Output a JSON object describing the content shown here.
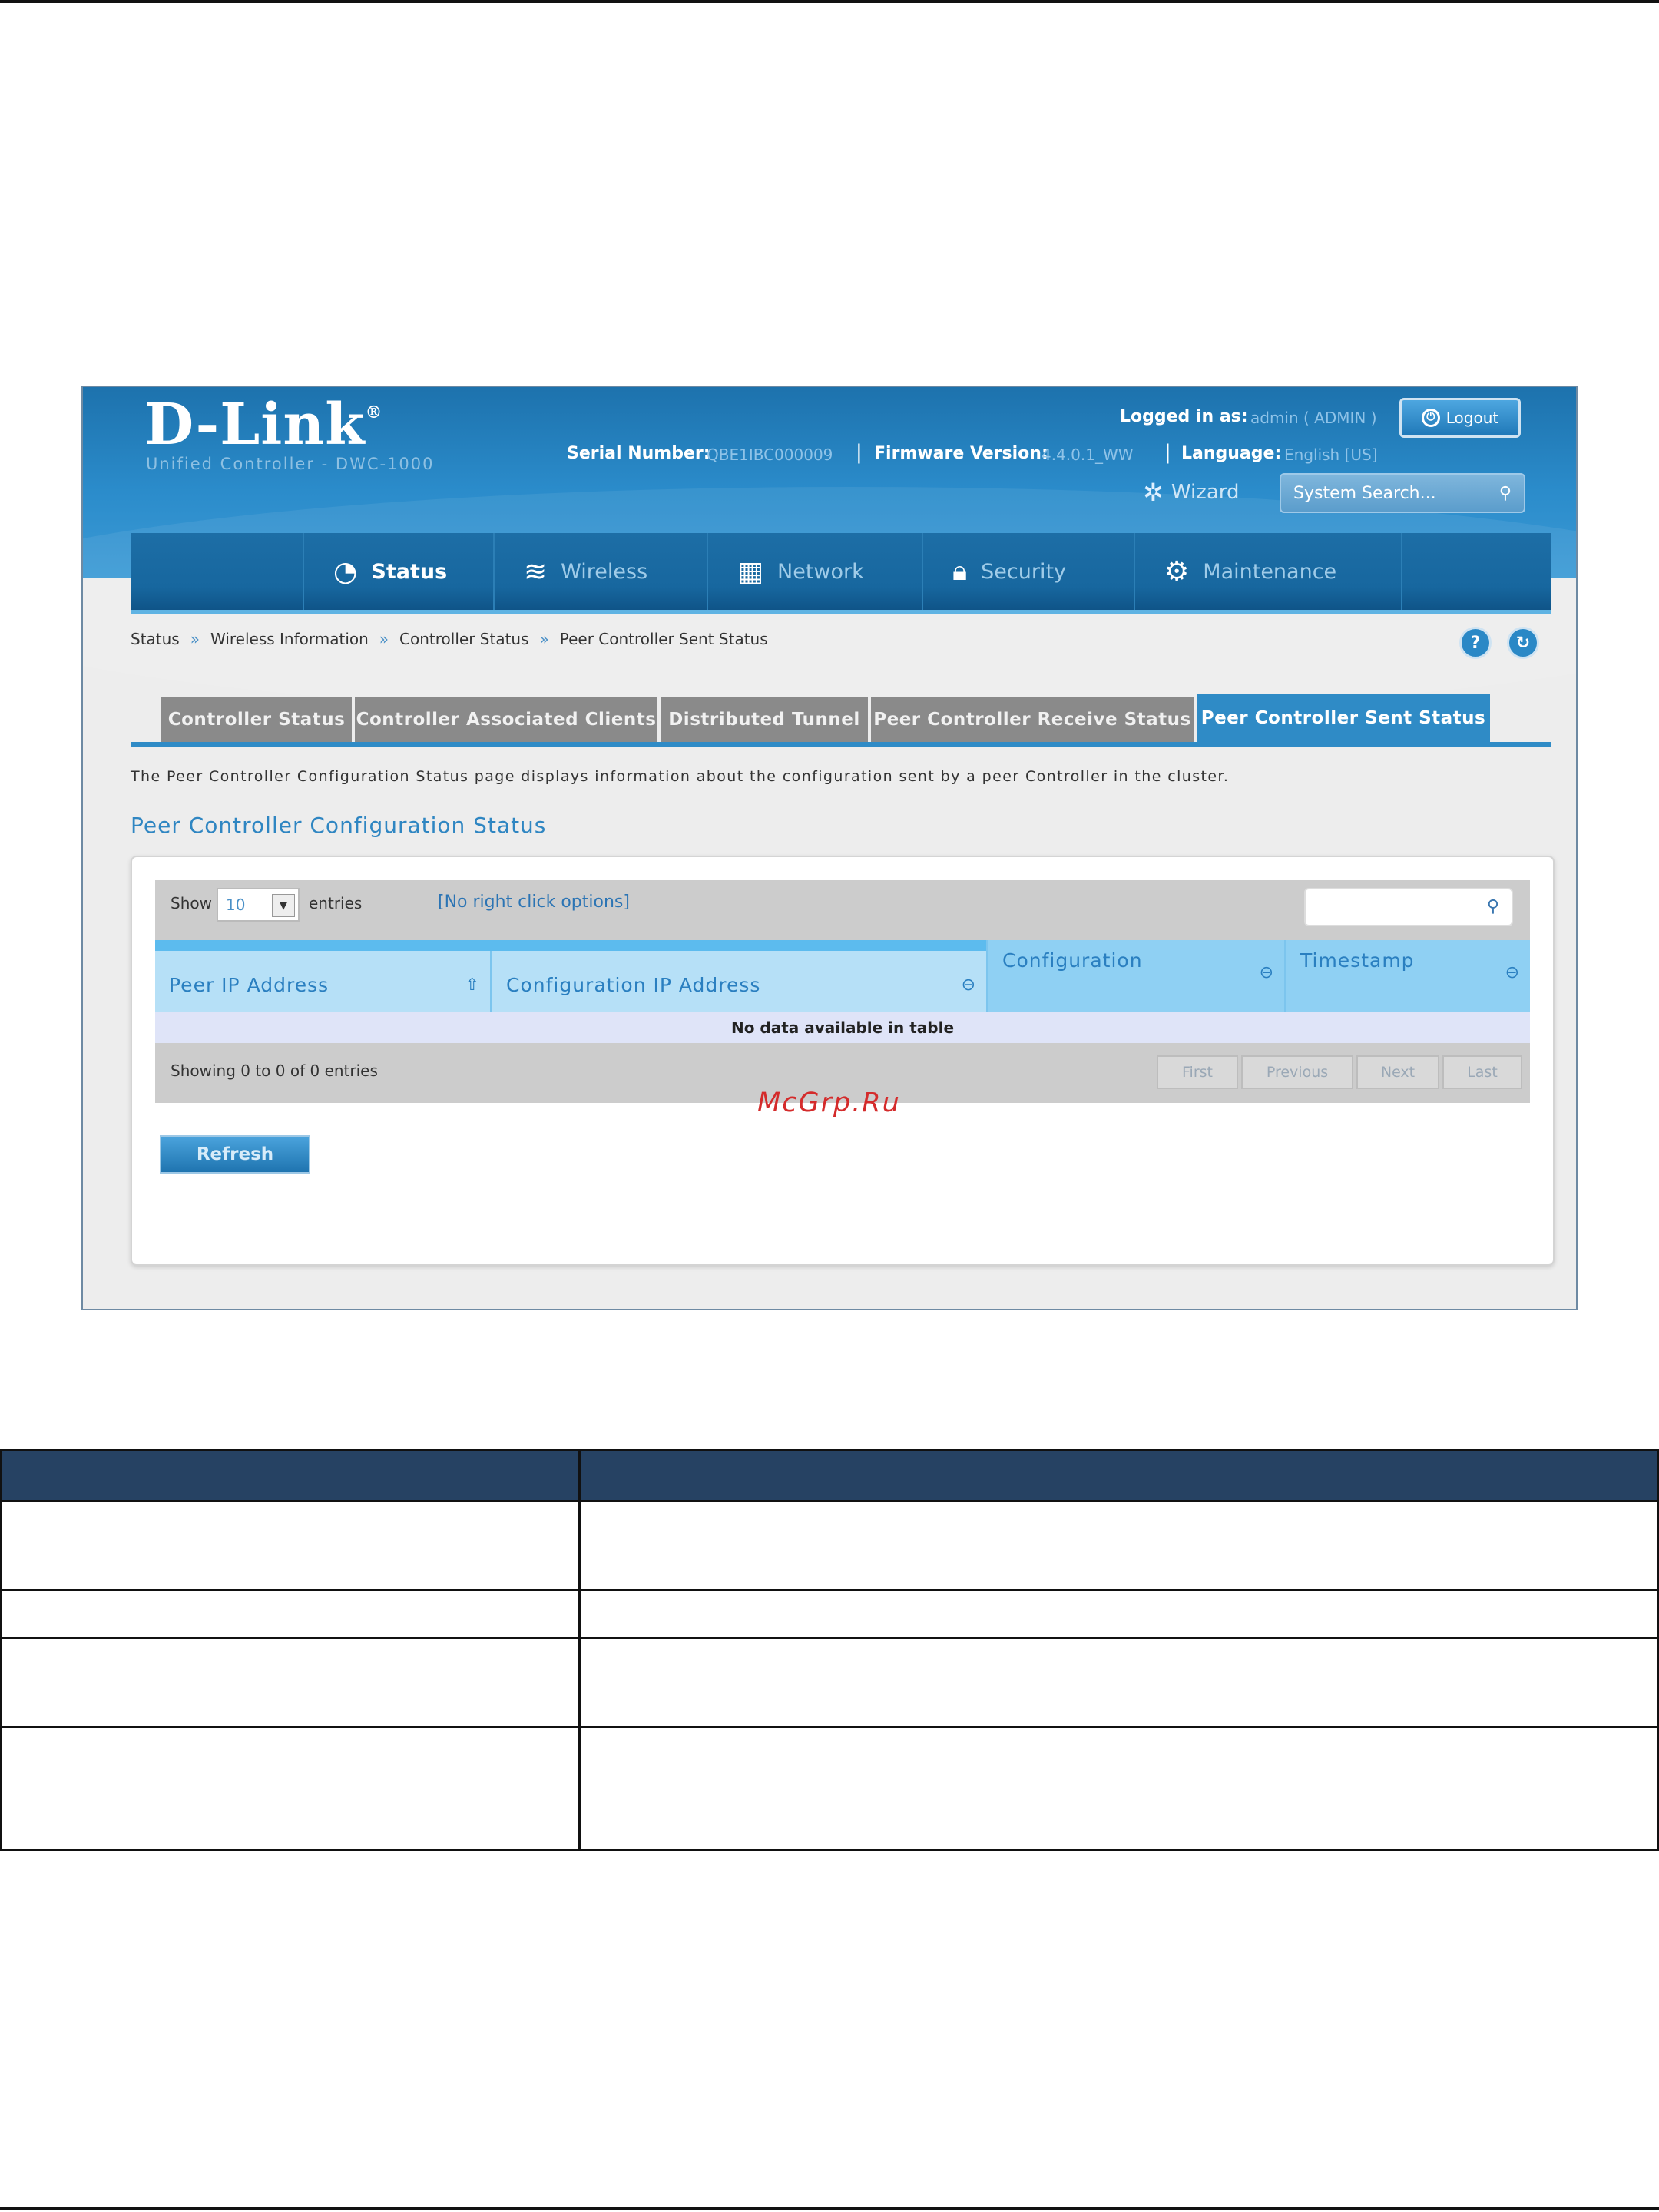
{
  "header": {
    "logo": "D-Link",
    "logo_mark": "®",
    "subtitle": "Unified Controller - DWC-1000",
    "logged_in_label": "Logged in as:",
    "logged_in_user": "admin ( ADMIN )",
    "logout_label": "Logout",
    "serial_label": "Serial Number:",
    "serial_value": "QBE1IBC000009",
    "firmware_label": "Firmware Version:",
    "firmware_value": "4.4.0.1_WW",
    "language_label": "Language:",
    "language_value": "English [US]",
    "wizard_label": "Wizard",
    "search_placeholder": "System Search..."
  },
  "nav": [
    {
      "label": "Status",
      "icon": "gauge-icon",
      "active": true
    },
    {
      "label": "Wireless",
      "icon": "wifi-icon",
      "active": false
    },
    {
      "label": "Network",
      "icon": "network-icon",
      "active": false
    },
    {
      "label": "Security",
      "icon": "lock-icon",
      "active": false
    },
    {
      "label": "Maintenance",
      "icon": "gears-icon",
      "active": false
    }
  ],
  "breadcrumb": [
    "Status",
    "Wireless Information",
    "Controller Status",
    "Peer Controller Sent Status"
  ],
  "breadcrumb_sep": "»",
  "tabs": [
    {
      "label": "Controller Status",
      "active": false
    },
    {
      "label": "Controller Associated Clients",
      "active": false
    },
    {
      "label": "Distributed Tunnel",
      "active": false
    },
    {
      "label": "Peer Controller Receive Status",
      "active": false
    },
    {
      "label": "Peer Controller Sent Status",
      "active": true
    }
  ],
  "description": "The Peer Controller Configuration Status page displays information about the configuration sent by a peer Controller in the cluster.",
  "section_title": "Peer Controller Configuration Status",
  "table": {
    "show_label": "Show",
    "entries_value": "10",
    "entries_label": "entries",
    "no_right_click": "[No right click options]",
    "columns": [
      "Peer IP Address",
      "Configuration IP Address",
      "Configuration",
      "Timestamp"
    ],
    "empty_message": "No data available in table",
    "showing": "Showing 0 to 0 of 0 entries",
    "pagination": [
      "First",
      "Previous",
      "Next",
      "Last"
    ]
  },
  "refresh_label": "Refresh",
  "watermark": "McGrp.Ru",
  "colors": {
    "header_blue": "#2b8ccb",
    "nav_blue": "#17679f",
    "tab_active": "#2f8bc6",
    "tab_inactive": "#8a8a8a",
    "table_header": "#5cbbee",
    "doc_header": "#264263",
    "watermark": "#d42b2b"
  }
}
